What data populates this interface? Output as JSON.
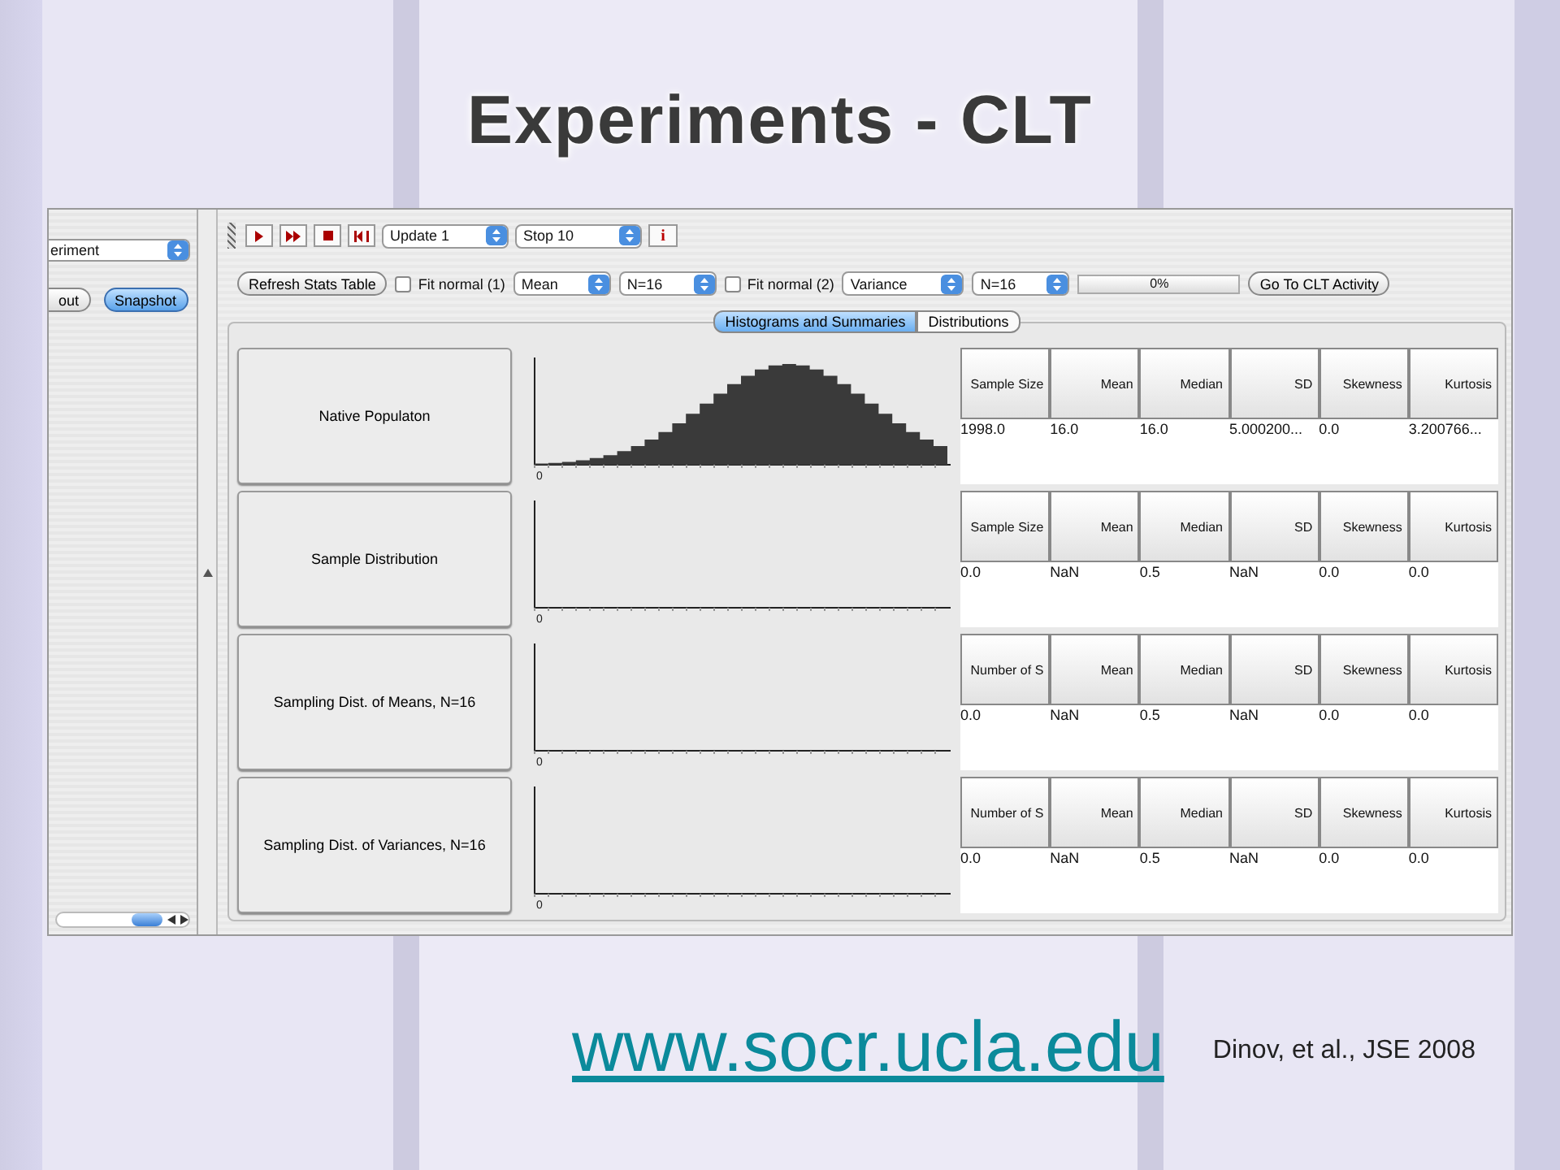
{
  "slide": {
    "title": "Experiments - CLT",
    "link": "www.socr.ucla.edu",
    "citation": "Dinov, et al., JSE 2008"
  },
  "left_panel": {
    "dropdown": "eriment",
    "buttons": [
      {
        "label": "out",
        "selected": false
      },
      {
        "label": "Snapshot",
        "selected": true
      }
    ]
  },
  "toolbar": {
    "dropdowns": [
      "Update 1",
      "Stop 10"
    ],
    "info_button": "i"
  },
  "controls": [
    {
      "kind": "button",
      "label": "Refresh Stats Table"
    },
    {
      "kind": "checkbox",
      "label": "Fit normal (1)",
      "checked": false
    },
    {
      "kind": "select",
      "value": "Mean"
    },
    {
      "kind": "select",
      "value": "N=16"
    },
    {
      "kind": "checkbox",
      "label": "Fit normal (2)",
      "checked": false
    },
    {
      "kind": "select",
      "value": "Variance"
    },
    {
      "kind": "select",
      "value": "N=16"
    },
    {
      "kind": "progress",
      "label": "0%",
      "level": 0
    },
    {
      "kind": "button",
      "label": "Go To CLT Activity"
    }
  ],
  "tabs": [
    {
      "label": "Histograms and Summaries",
      "selected": true
    },
    {
      "label": "Distributions",
      "selected": false
    }
  ],
  "rows": [
    {
      "label": "Native Populaton",
      "bars_shown": true,
      "axis_label": "0",
      "columns": [
        "Sample Size",
        "Mean",
        "Median",
        "SD",
        "Skewness",
        "Kurtosis"
      ],
      "values": [
        "1998.0",
        "16.0",
        "16.0",
        "5.000200...",
        "0.0",
        "3.200766..."
      ]
    },
    {
      "label": "Sample Distribution",
      "bars_shown": false,
      "axis_label": "0",
      "columns": [
        "Sample Size",
        "Mean",
        "Median",
        "SD",
        "Skewness",
        "Kurtosis"
      ],
      "values": [
        "0.0",
        "NaN",
        "0.5",
        "NaN",
        "0.0",
        "0.0"
      ]
    },
    {
      "label": "Sampling Dist. of  Means, N=16",
      "bars_shown": false,
      "axis_label": "0",
      "columns": [
        "Number of S",
        "Mean",
        "Median",
        "SD",
        "Skewness",
        "Kurtosis"
      ],
      "values": [
        "0.0",
        "NaN",
        "0.5",
        "NaN",
        "0.0",
        "0.0"
      ]
    },
    {
      "label": "Sampling Dist. of  Variances, N=16",
      "bars_shown": false,
      "axis_label": "0",
      "columns": [
        "Number of S",
        "Mean",
        "Median",
        "SD",
        "Skewness",
        "Kurtosis"
      ],
      "values": [
        "0.0",
        "NaN",
        "0.5",
        "NaN",
        "0.0",
        "0.0"
      ]
    }
  ]
}
